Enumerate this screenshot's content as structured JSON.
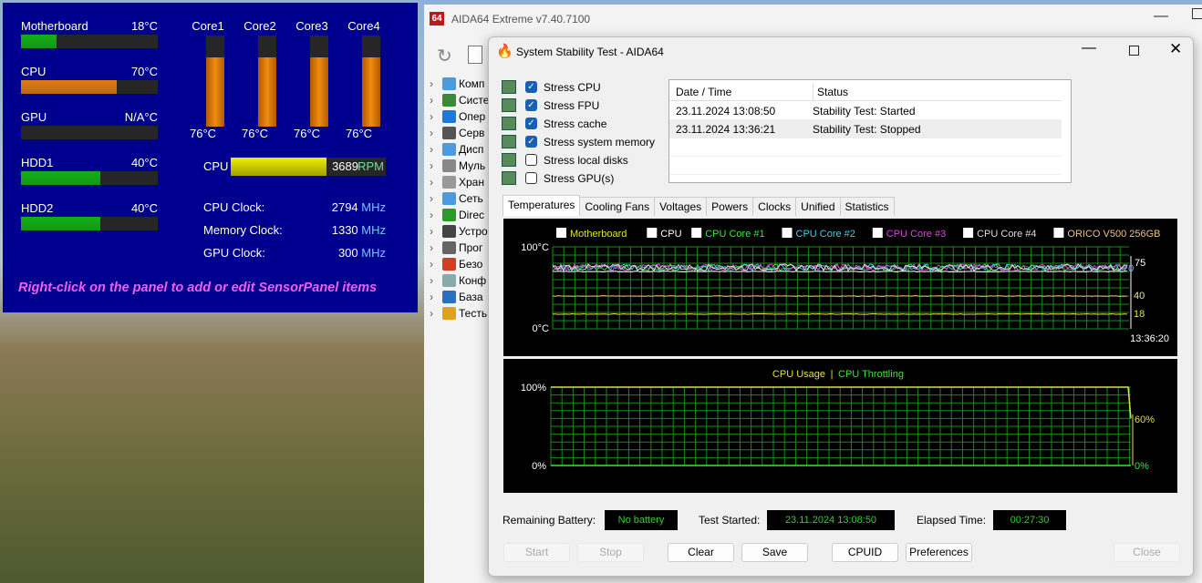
{
  "sensor_panel": {
    "bars": [
      {
        "name": "Motherboard",
        "value": "18°C",
        "pct": 26,
        "color": "#12b012"
      },
      {
        "name": "CPU",
        "value": "70°C",
        "pct": 70,
        "color": "#e07a10"
      },
      {
        "name": "GPU",
        "value": "N/A°C",
        "pct": 0,
        "color": "#12b012"
      },
      {
        "name": "HDD1",
        "value": "40°C",
        "pct": 58,
        "color": "#12b012"
      },
      {
        "name": "HDD2",
        "value": "40°C",
        "pct": 58,
        "color": "#12b012"
      }
    ],
    "cores": [
      {
        "name": "Core1",
        "value": "76°C",
        "pct": 76
      },
      {
        "name": "Core2",
        "value": "76°C",
        "pct": 76
      },
      {
        "name": "Core3",
        "value": "76°C",
        "pct": 76
      },
      {
        "name": "Core4",
        "value": "76°C",
        "pct": 76
      }
    ],
    "fan": {
      "label": "CPU",
      "value": "3689",
      "unit": "RPM",
      "pct": 62
    },
    "clocks": [
      {
        "label": "CPU Clock:",
        "value": "2794",
        "unit": "MHz"
      },
      {
        "label": "Memory Clock:",
        "value": "1330",
        "unit": "MHz"
      },
      {
        "label": "GPU Clock:",
        "value": "300",
        "unit": "MHz"
      }
    ],
    "hint": "Right-click on the panel to add or edit SensorPanel items"
  },
  "main_window": {
    "logo": "64",
    "title": "AIDA64 Extreme v7.40.7100",
    "tree": [
      {
        "label": "Комп",
        "color": "#4a9be0"
      },
      {
        "label": "Систе",
        "color": "#3a8a3a"
      },
      {
        "label": "Опер",
        "color": "#1e7ad8"
      },
      {
        "label": "Серв",
        "color": "#555"
      },
      {
        "label": "Дисп",
        "color": "#4a9be0"
      },
      {
        "label": "Муль",
        "color": "#888"
      },
      {
        "label": "Хран",
        "color": "#999"
      },
      {
        "label": "Сеть",
        "color": "#4a9be0"
      },
      {
        "label": "Direc",
        "color": "#2a9a2a"
      },
      {
        "label": "Устро",
        "color": "#444"
      },
      {
        "label": "Прог",
        "color": "#666"
      },
      {
        "label": "Безо",
        "color": "#d04020"
      },
      {
        "label": "Конф",
        "color": "#8aa"
      },
      {
        "label": "База",
        "color": "#2a70c0"
      },
      {
        "label": "Тесть",
        "color": "#e0a020"
      }
    ]
  },
  "dialog": {
    "title": "System Stability Test - AIDA64",
    "stress": [
      {
        "label": "Stress CPU",
        "checked": true
      },
      {
        "label": "Stress FPU",
        "checked": true
      },
      {
        "label": "Stress cache",
        "checked": true
      },
      {
        "label": "Stress system memory",
        "checked": true
      },
      {
        "label": "Stress local disks",
        "checked": false
      },
      {
        "label": "Stress GPU(s)",
        "checked": false
      }
    ],
    "log": {
      "headers": [
        "Date / Time",
        "Status"
      ],
      "rows": [
        [
          "23.11.2024 13:08:50",
          "Stability Test: Started"
        ],
        [
          "23.11.2024 13:36:21",
          "Stability Test: Stopped"
        ]
      ]
    },
    "tabs": [
      "Temperatures",
      "Cooling Fans",
      "Voltages",
      "Powers",
      "Clocks",
      "Unified",
      "Statistics"
    ],
    "status": {
      "battery_label": "Remaining Battery:",
      "battery": "No battery",
      "started_label": "Test Started:",
      "started": "23.11.2024 13:08:50",
      "elapsed_label": "Elapsed Time:",
      "elapsed": "00:27:30"
    },
    "buttons": {
      "start": "Start",
      "stop": "Stop",
      "clear": "Clear",
      "save": "Save",
      "cpuid": "CPUID",
      "preferences": "Preferences",
      "close": "Close"
    }
  },
  "chart_data": [
    {
      "type": "line",
      "title": "Temperatures",
      "ylim": [
        0,
        100
      ],
      "ytick_labels": [
        "100°C",
        "0°C"
      ],
      "x_end_label": "13:36:20",
      "series": [
        {
          "name": "Motherboard",
          "color": "#e0e040",
          "value": 18
        },
        {
          "name": "CPU",
          "color": "#ffffff",
          "value": 70
        },
        {
          "name": "CPU Core #1",
          "color": "#40e040",
          "value": 75
        },
        {
          "name": "CPU Core #2",
          "color": "#40d0e0",
          "value": 75
        },
        {
          "name": "CPU Core #3",
          "color": "#e040e0",
          "value": 75
        },
        {
          "name": "CPU Core #4",
          "color": "#dddddd",
          "value": 75
        },
        {
          "name": "ORICO V500 256GB",
          "color": "#f0c080",
          "value": 40
        }
      ],
      "right_labels": [
        "75",
        "70",
        "40",
        "18"
      ]
    },
    {
      "type": "line",
      "title": "CPU Usage | CPU Throttling",
      "ylim": [
        0,
        100
      ],
      "ytick_labels": [
        "100%",
        "0%"
      ],
      "series": [
        {
          "name": "CPU Usage",
          "color": "#e0e040",
          "values_summary": [
            100,
            60
          ]
        },
        {
          "name": "CPU Throttling",
          "color": "#40e040",
          "value": 0
        }
      ],
      "right_labels": [
        "60%",
        "0%"
      ],
      "sep": "|"
    }
  ]
}
